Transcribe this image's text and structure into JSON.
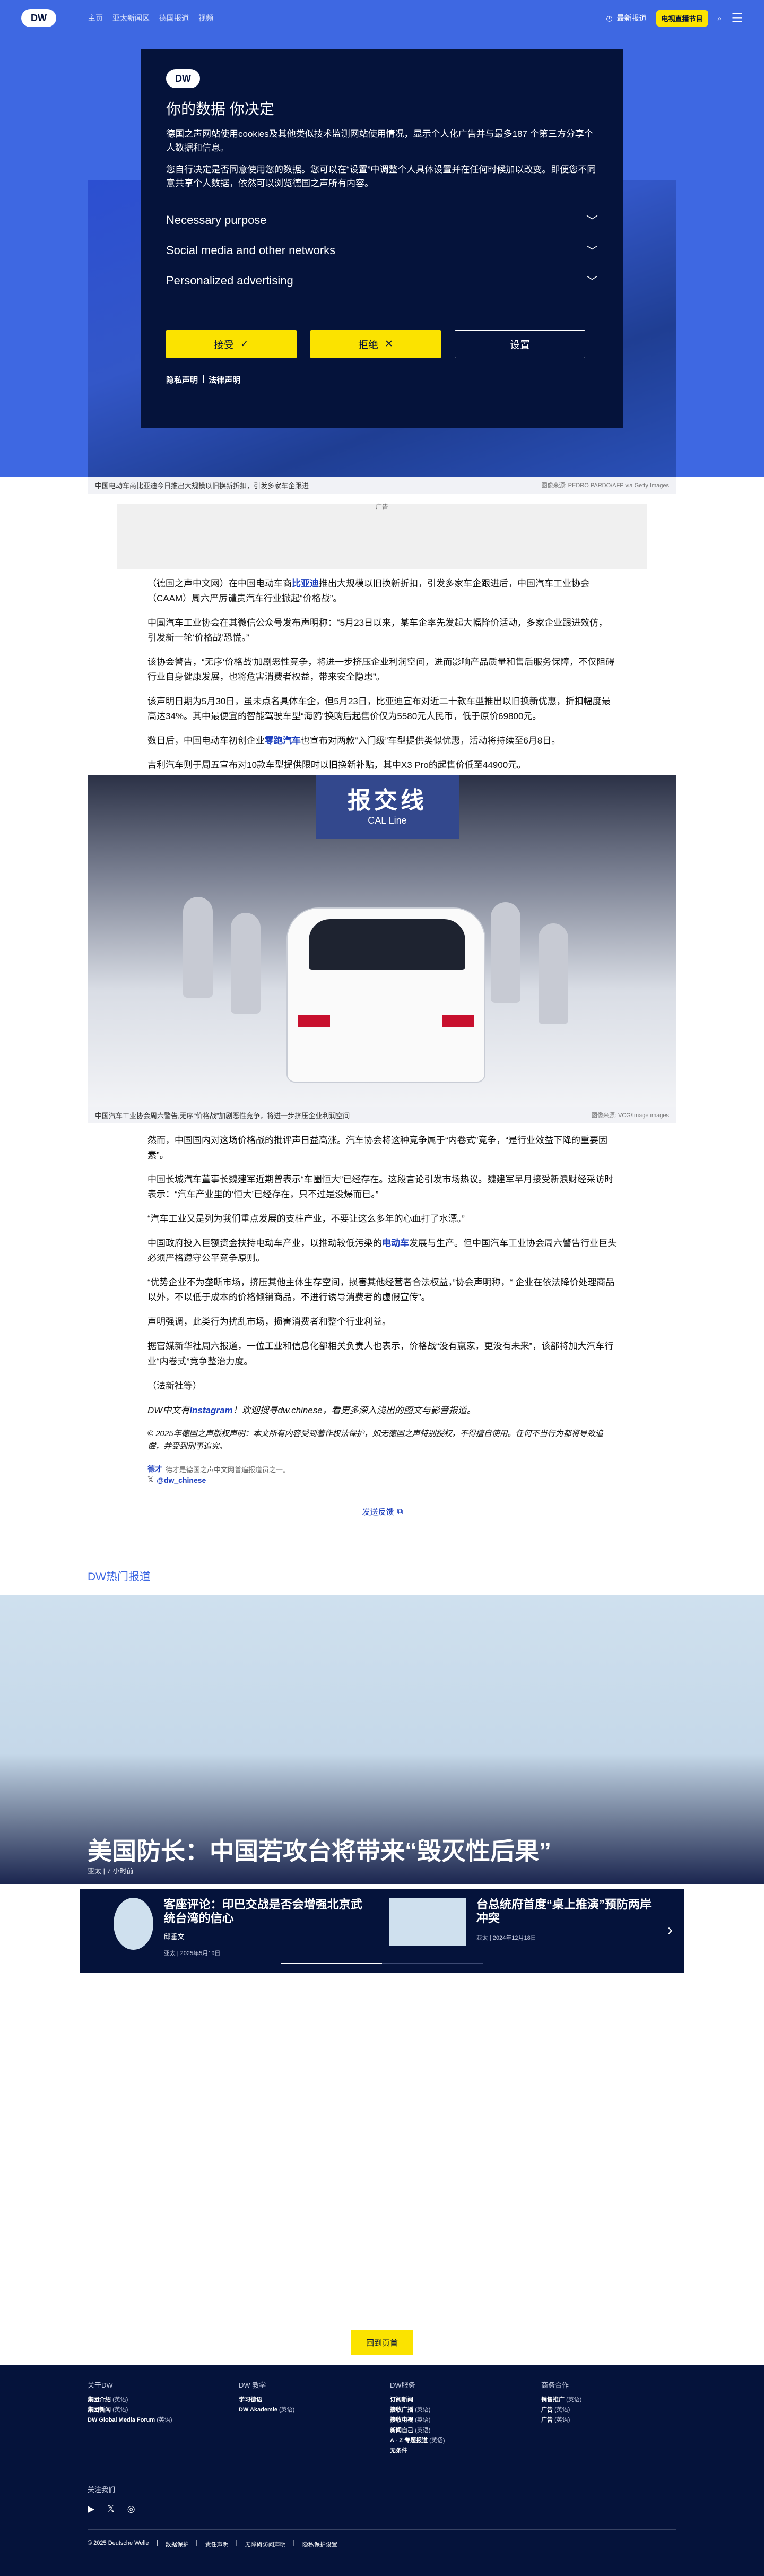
{
  "topbar": {
    "logo": "DW",
    "breadcrumbs": [
      "主页",
      "亚太新闻区",
      "德国报道",
      "视频"
    ],
    "lang_label": "最新报道",
    "media_label": "电视直播节目",
    "menu_icon": "hamburger-icon"
  },
  "modal": {
    "logo": "DW",
    "title": "你的数据 你决定",
    "p1": "德国之声网站使用cookies及其他类似技术监测网站使用情况，显示个人化广告并与最多187 个第三方分享个人数据和信息。",
    "p2": "您自行决定是否同意使用您的数据。您可以在“设置”中调整个人具体设置并在任何时候加以改变。即便您不同意共享个人数据，依然可以浏览德国之声所有内容。",
    "purposes": [
      "Necessary purpose",
      "Social media and other networks",
      "Personalized advertising"
    ],
    "accept": "接受",
    "reject": "拒绝",
    "settings": "设置",
    "privacy": "隐私声明",
    "legal": "法律声明"
  },
  "hero": {
    "caption": "中国电动车商比亚迪今日推出大规模以旧换新折扣，引发多家车企跟进",
    "credit": "图像来源: PEDRO PARDO/AFP via Getty Images"
  },
  "ad_label": "广告",
  "article": {
    "p1_a": "（德国之声中文网）在中国电动车商",
    "p1_link": "比亚迪",
    "p1_b": "推出大规模以旧换新折扣，引发多家车企跟进后，中国汽车工业协会（CAAM）周六严厉谴责汽车行业掀起“价格战”。",
    "p2": "中国汽车工业协会在其微信公众号发布声明称：“5月23日以来，某车企率先发起大幅降价活动，多家企业跟进效仿，引发新一轮‘价格战’恐慌。”",
    "p3": "该协会警告，“无序‘价格战’加剧恶性竞争，将进一步挤压企业利润空间，进而影响产品质量和售后服务保障，不仅阻碍行业自身健康发展，也将危害消费者权益，带来安全隐患”。",
    "p4": "该声明日期为5月30日，虽未点名具体车企，但5月23日，比亚迪宣布对近二十款车型推出以旧换新优惠，折扣幅度最高达34%。其中最便宜的智能驾驶车型“海鸥”换购后起售价仅为5580元人民币，低于原价69800元。",
    "p5_a": "数日后，中国电动车初创企业",
    "p5_link": "零跑汽车",
    "p5_b": "也宣布对两款“入门级”车型提供类似优惠，活动将持续至6月8日。",
    "p6": "吉利汽车则于周五宣布对10款车型提供限时以旧换新补贴，其中X3 Pro的起售价低至44900元。",
    "img_banner_big": "报交线",
    "img_banner_small": "CAL Line",
    "img_caption": "中国汽车工业协会周六警告,无序“价格战”加剧恶性竞争，将进一步挤压企业利润空间",
    "img_credit": "图像来源: VCG/Image images",
    "p7": "然而，中国国内对这场价格战的批评声日益高涨。汽车协会将这种竞争属于“内卷式”竞争，“是行业效益下降的重要因素”。",
    "p8": "中国长城汽车董事长魏建军近期曾表示“车圈恒大”已经存在。这段言论引发市场热议。魏建军早月接受新浪财经采访时表示：“汽车产业里的‘恒大’已经存在，只不过是没爆而已。”",
    "p9": "“汽车工业又是列为我们重点发展的支柱产业，不要让这么多年的心血打了水漂。”",
    "p10_a": "中国政府投入巨额资金扶持电动车产业，以推动较低污染的",
    "p10_link": "电动车",
    "p10_b": "发展与生产。但中国汽车工业协会周六警告行业巨头必须严格遵守公平竞争原则。",
    "p11": "“优势企业不为垄断市场，挤压其他主体生存空间，损害其他经营者合法权益，”协会声明称，“ 企业在依法降价处理商品以外，不以低于成本的价格倾销商品，不进行诱导消费者的虚假宣传”。",
    "p12": "声明强调，此类行为扰乱市场，损害消费者和整个行业利益。",
    "p13": "据官媒新华社周六报道，一位工业和信息化部相关负责人也表示，价格战“没有赢家，更没有未来”，该部将加大汽车行业“内卷式”竞争整治力度。",
    "p14": "（法新社等）",
    "p15_a": "DW中文有",
    "p15_link": "Instagram",
    "p15_b": "！欢迎搜寻dw.chinese，看更多深入浅出的图文与影音报道。",
    "copyright": "© 2025年德国之声版权声明：本文所有内容受到著作权法保护，如无德国之声特别授权，不得擅自使用。任何不当行为都将导致追偿，并受到刑事追究。",
    "tag_author": "德才",
    "tag_desc": "德才是德国之声中文网普遍报道员之一。",
    "tag_handle": "@dw_chinese",
    "feedback": "发送反馈"
  },
  "hot": {
    "section_title": "DW热门报道",
    "title": "美国防长：中国若攻台将带来“毁灭性后果”",
    "meta": "亚太 | 7 小时前",
    "teasers": [
      {
        "title": "客座评论：印巴交战是否会增强北京武统台湾的信心",
        "author": "邱垂文",
        "meta": "亚太 | 2025年5月19日"
      },
      {
        "title": "台总统府首度“桌上推演”预防两岸冲突",
        "author": "",
        "meta": "亚太 | 2024年12月18日"
      }
    ],
    "progress": 0.5
  },
  "back_top": "回到页首",
  "footer": {
    "cols": [
      {
        "heading": "关于DW",
        "links": [
          {
            "t": "集团介绍",
            "s": "(英语)"
          },
          {
            "t": "集团新闻",
            "s": "(英语)"
          },
          {
            "t": "DW Global Media Forum",
            "s": "(英语)"
          }
        ]
      },
      {
        "heading": "DW 教学",
        "links": [
          {
            "t": "学习德语",
            "s": ""
          },
          {
            "t": "DW Akademie",
            "s": "(英语)"
          }
        ]
      },
      {
        "heading": "DW服务",
        "links": [
          {
            "t": "订阅新闻",
            "s": ""
          },
          {
            "t": "接收广播",
            "s": "(英语)"
          },
          {
            "t": "接收电视",
            "s": "(英语)"
          },
          {
            "t": "新闻自己",
            "s": "(英语)"
          },
          {
            "t": "A - Z 专题报道",
            "s": "(英语)"
          },
          {
            "t": "无条件",
            "s": ""
          }
        ]
      },
      {
        "heading": "商务合作",
        "links": [
          {
            "t": "销售推广",
            "s": "(英语)"
          },
          {
            "t": "广告",
            "s": "(英语)"
          },
          {
            "t": "广告",
            "s": "(英语)"
          }
        ]
      }
    ],
    "follow": "关注我们",
    "social_icons": [
      "youtube-icon",
      "x-icon",
      "instagram-icon"
    ],
    "bottom": [
      "© 2025 Deutsche Welle",
      "数据保护",
      "责任声明",
      "无障碍访问声明",
      "隐私保护设置"
    ]
  }
}
